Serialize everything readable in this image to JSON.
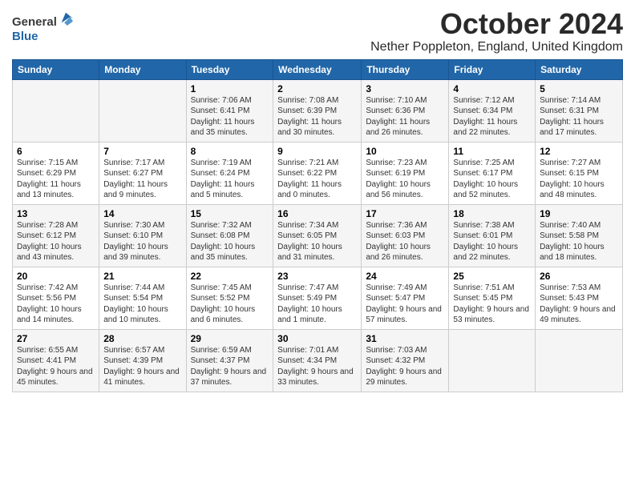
{
  "logo": {
    "general": "General",
    "blue": "Blue"
  },
  "title": "October 2024",
  "location": "Nether Poppleton, England, United Kingdom",
  "days_of_week": [
    "Sunday",
    "Monday",
    "Tuesday",
    "Wednesday",
    "Thursday",
    "Friday",
    "Saturday"
  ],
  "weeks": [
    [
      {
        "day": "",
        "detail": ""
      },
      {
        "day": "",
        "detail": ""
      },
      {
        "day": "1",
        "detail": "Sunrise: 7:06 AM\nSunset: 6:41 PM\nDaylight: 11 hours and 35 minutes."
      },
      {
        "day": "2",
        "detail": "Sunrise: 7:08 AM\nSunset: 6:39 PM\nDaylight: 11 hours and 30 minutes."
      },
      {
        "day": "3",
        "detail": "Sunrise: 7:10 AM\nSunset: 6:36 PM\nDaylight: 11 hours and 26 minutes."
      },
      {
        "day": "4",
        "detail": "Sunrise: 7:12 AM\nSunset: 6:34 PM\nDaylight: 11 hours and 22 minutes."
      },
      {
        "day": "5",
        "detail": "Sunrise: 7:14 AM\nSunset: 6:31 PM\nDaylight: 11 hours and 17 minutes."
      }
    ],
    [
      {
        "day": "6",
        "detail": "Sunrise: 7:15 AM\nSunset: 6:29 PM\nDaylight: 11 hours and 13 minutes."
      },
      {
        "day": "7",
        "detail": "Sunrise: 7:17 AM\nSunset: 6:27 PM\nDaylight: 11 hours and 9 minutes."
      },
      {
        "day": "8",
        "detail": "Sunrise: 7:19 AM\nSunset: 6:24 PM\nDaylight: 11 hours and 5 minutes."
      },
      {
        "day": "9",
        "detail": "Sunrise: 7:21 AM\nSunset: 6:22 PM\nDaylight: 11 hours and 0 minutes."
      },
      {
        "day": "10",
        "detail": "Sunrise: 7:23 AM\nSunset: 6:19 PM\nDaylight: 10 hours and 56 minutes."
      },
      {
        "day": "11",
        "detail": "Sunrise: 7:25 AM\nSunset: 6:17 PM\nDaylight: 10 hours and 52 minutes."
      },
      {
        "day": "12",
        "detail": "Sunrise: 7:27 AM\nSunset: 6:15 PM\nDaylight: 10 hours and 48 minutes."
      }
    ],
    [
      {
        "day": "13",
        "detail": "Sunrise: 7:28 AM\nSunset: 6:12 PM\nDaylight: 10 hours and 43 minutes."
      },
      {
        "day": "14",
        "detail": "Sunrise: 7:30 AM\nSunset: 6:10 PM\nDaylight: 10 hours and 39 minutes."
      },
      {
        "day": "15",
        "detail": "Sunrise: 7:32 AM\nSunset: 6:08 PM\nDaylight: 10 hours and 35 minutes."
      },
      {
        "day": "16",
        "detail": "Sunrise: 7:34 AM\nSunset: 6:05 PM\nDaylight: 10 hours and 31 minutes."
      },
      {
        "day": "17",
        "detail": "Sunrise: 7:36 AM\nSunset: 6:03 PM\nDaylight: 10 hours and 26 minutes."
      },
      {
        "day": "18",
        "detail": "Sunrise: 7:38 AM\nSunset: 6:01 PM\nDaylight: 10 hours and 22 minutes."
      },
      {
        "day": "19",
        "detail": "Sunrise: 7:40 AM\nSunset: 5:58 PM\nDaylight: 10 hours and 18 minutes."
      }
    ],
    [
      {
        "day": "20",
        "detail": "Sunrise: 7:42 AM\nSunset: 5:56 PM\nDaylight: 10 hours and 14 minutes."
      },
      {
        "day": "21",
        "detail": "Sunrise: 7:44 AM\nSunset: 5:54 PM\nDaylight: 10 hours and 10 minutes."
      },
      {
        "day": "22",
        "detail": "Sunrise: 7:45 AM\nSunset: 5:52 PM\nDaylight: 10 hours and 6 minutes."
      },
      {
        "day": "23",
        "detail": "Sunrise: 7:47 AM\nSunset: 5:49 PM\nDaylight: 10 hours and 1 minute."
      },
      {
        "day": "24",
        "detail": "Sunrise: 7:49 AM\nSunset: 5:47 PM\nDaylight: 9 hours and 57 minutes."
      },
      {
        "day": "25",
        "detail": "Sunrise: 7:51 AM\nSunset: 5:45 PM\nDaylight: 9 hours and 53 minutes."
      },
      {
        "day": "26",
        "detail": "Sunrise: 7:53 AM\nSunset: 5:43 PM\nDaylight: 9 hours and 49 minutes."
      }
    ],
    [
      {
        "day": "27",
        "detail": "Sunrise: 6:55 AM\nSunset: 4:41 PM\nDaylight: 9 hours and 45 minutes."
      },
      {
        "day": "28",
        "detail": "Sunrise: 6:57 AM\nSunset: 4:39 PM\nDaylight: 9 hours and 41 minutes."
      },
      {
        "day": "29",
        "detail": "Sunrise: 6:59 AM\nSunset: 4:37 PM\nDaylight: 9 hours and 37 minutes."
      },
      {
        "day": "30",
        "detail": "Sunrise: 7:01 AM\nSunset: 4:34 PM\nDaylight: 9 hours and 33 minutes."
      },
      {
        "day": "31",
        "detail": "Sunrise: 7:03 AM\nSunset: 4:32 PM\nDaylight: 9 hours and 29 minutes."
      },
      {
        "day": "",
        "detail": ""
      },
      {
        "day": "",
        "detail": ""
      }
    ]
  ]
}
